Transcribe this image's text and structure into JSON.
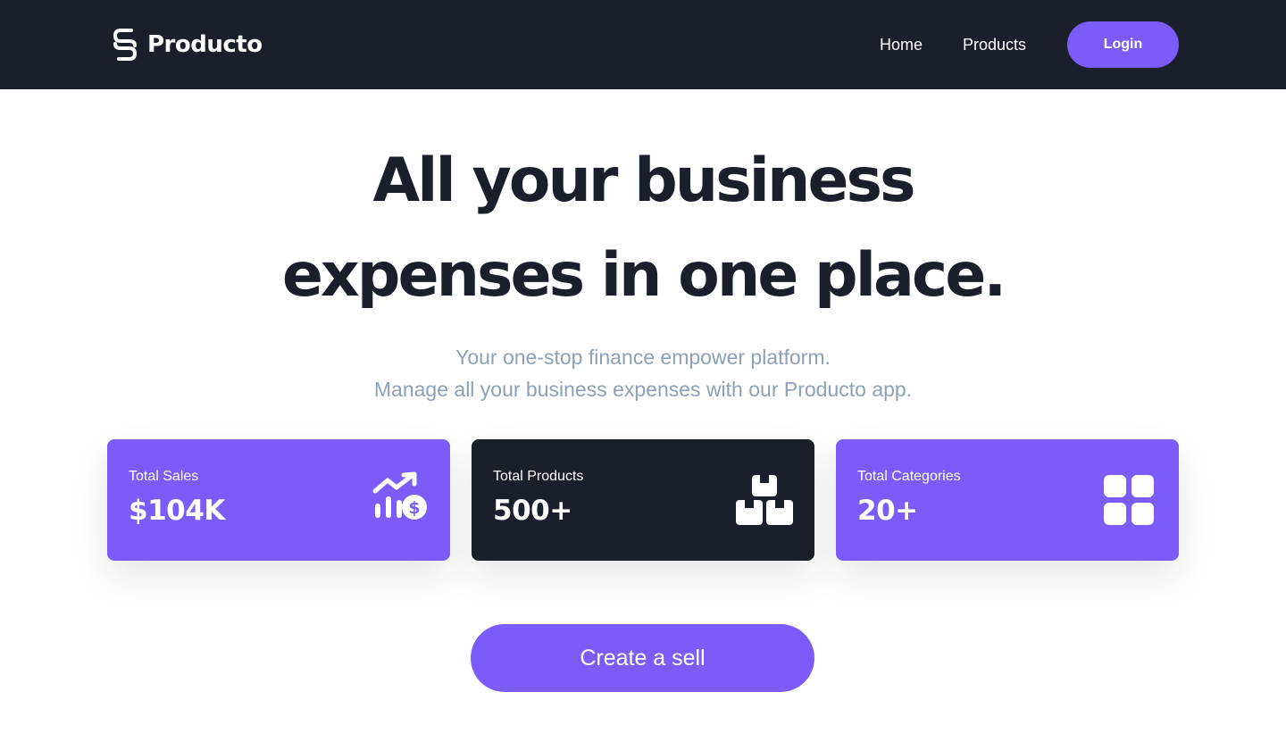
{
  "brand": {
    "name": "Producto",
    "logo_icon": "paperclip-s-icon"
  },
  "nav": {
    "home": "Home",
    "products": "Products",
    "login": "Login"
  },
  "hero": {
    "title_line1": "All your business",
    "title_line2": "expenses in one place.",
    "subtitle_line1": "Your one-stop finance empower platform.",
    "subtitle_line2": "Manage all your business expenses with our Producto app."
  },
  "stats": [
    {
      "label": "Total Sales",
      "value": "$104K",
      "icon": "sales-growth-icon",
      "background": "#7b5cfa"
    },
    {
      "label": "Total Products",
      "value": "500+",
      "icon": "boxes-icon",
      "background": "#1b1e2b"
    },
    {
      "label": "Total Categories",
      "value": "20+",
      "icon": "grid-icon",
      "background": "#7b5cfa"
    }
  ],
  "cta": {
    "label": "Create a sell"
  },
  "colors": {
    "accent": "#7b5cfa",
    "dark": "#1b1e2b",
    "muted_text": "#8da0b9"
  }
}
